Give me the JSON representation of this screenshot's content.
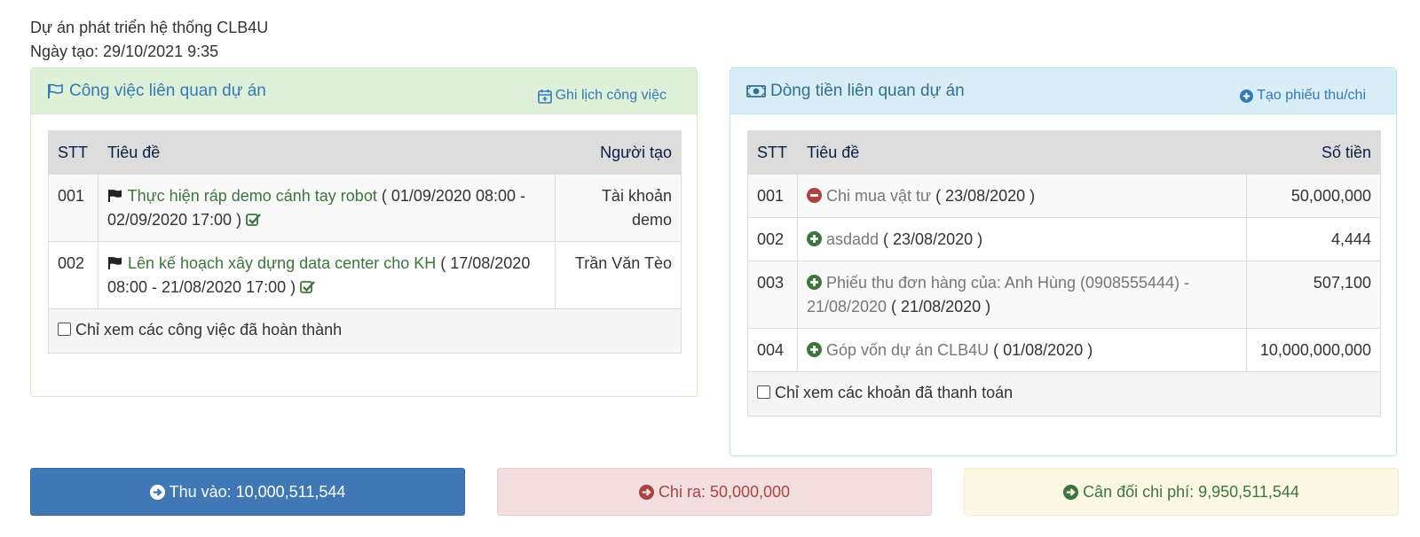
{
  "project": {
    "name": "Dự án phát triển hệ thống CLB4U",
    "created": "Ngày tạo: 29/10/2021 9:35"
  },
  "tasks_panel": {
    "title": "Công việc liên quan dự án",
    "action": "Ghi lịch công việc",
    "columns": {
      "stt": "STT",
      "title": "Tiêu đề",
      "creator": "Người tạo"
    },
    "rows": [
      {
        "stt": "001",
        "title": "Thực hiện ráp demo cánh tay robot",
        "period": "( 01/09/2020 08:00 - 02/09/2020 17:00 )",
        "creator": "Tài khoản demo"
      },
      {
        "stt": "002",
        "title": "Lên kế hoạch xây dựng data center cho KH",
        "period": "( 17/08/2020 08:00 - 21/08/2020 17:00 )",
        "creator": "Trần Văn Tèo"
      }
    ],
    "filter_label": "Chỉ xem các công việc đã hoàn thành"
  },
  "cash_panel": {
    "title": "Dòng tiền liên quan dự án",
    "action": "Tạo phiếu thu/chi",
    "columns": {
      "stt": "STT",
      "title": "Tiêu đề",
      "amount": "Số tiền"
    },
    "rows": [
      {
        "stt": "001",
        "kind": "expense",
        "title": "Chi mua vật tư",
        "date": "( 23/08/2020 )",
        "amount": "50,000,000"
      },
      {
        "stt": "002",
        "kind": "income",
        "title": "asdadd",
        "date": "( 23/08/2020 )",
        "amount": "4,444"
      },
      {
        "stt": "003",
        "kind": "income",
        "title": "Phiếu thu đơn hàng của: Anh Hùng (0908555444) - 21/08/2020",
        "date": "( 21/08/2020 )",
        "amount": "507,100"
      },
      {
        "stt": "004",
        "kind": "income",
        "title": "Góp vốn dự án CLB4U",
        "date": "( 01/08/2020 )",
        "amount": "10,000,000,000"
      }
    ],
    "filter_label": "Chỉ xem các khoản đã thanh toán"
  },
  "summary": {
    "income": "Thu vào: 10,000,511,544",
    "expense": "Chi ra: 50,000,000",
    "balance": "Cân đối chi phí: 9,950,511,544"
  },
  "colors": {
    "income_btn": "#3f78b4",
    "expense_btn": "#f2dede",
    "balance_btn": "#fcf8e3",
    "income_icon": "#3c763d",
    "expense_icon": "#a94442"
  }
}
